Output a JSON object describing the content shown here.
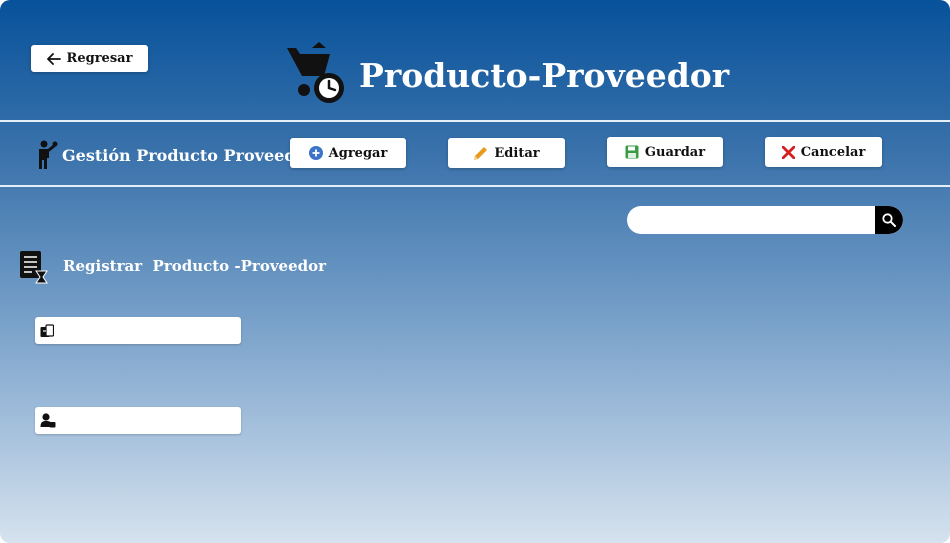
{
  "header": {
    "back_label": "Regresar",
    "title": "Producto-Proveedor"
  },
  "toolbar": {
    "section_title": "Gestión Producto Proveedor",
    "add_label": "Agregar",
    "edit_label": "Editar",
    "save_label": "Guardar",
    "cancel_label": "Cancelar"
  },
  "search": {
    "placeholder": ""
  },
  "form": {
    "title": "Registrar  Producto -Proveedor",
    "product_field": {
      "value": "",
      "placeholder": ""
    },
    "supplier_field": {
      "value": "",
      "placeholder": ""
    }
  },
  "colors": {
    "brand_blue": "#07529b",
    "add_blue": "#3b74c8",
    "edit_orange": "#e79a1c",
    "save_green": "#3a9b45",
    "cancel_red": "#d51f1f"
  },
  "icons": {
    "back": "arrow-left-icon",
    "title": "shopping-cart-clock-icon",
    "section": "person-icon",
    "add": "plus-circle-icon",
    "edit": "pencil-icon",
    "save": "floppy-disk-icon",
    "cancel": "x-icon",
    "search": "search-icon",
    "form": "document-list-icon",
    "product_field": "product-tag-icon",
    "supplier_field": "person-badge-icon"
  }
}
